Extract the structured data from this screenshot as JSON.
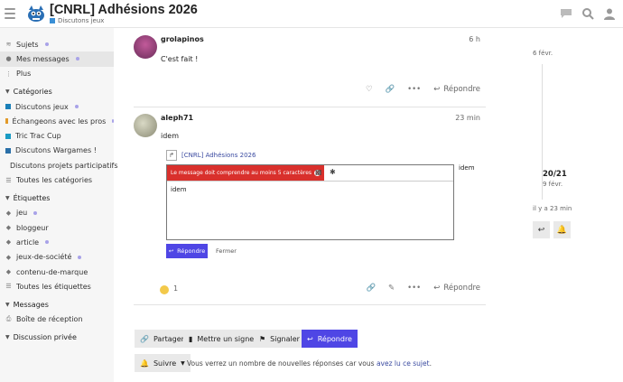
{
  "header": {
    "title": "[CNRL] Adhésions 2026",
    "category": "Discutons jeux",
    "category_color": "#3a8fd6"
  },
  "sidebar": {
    "top": [
      {
        "label": "Sujets",
        "icon": "layers-icon",
        "dot": true
      },
      {
        "label": "Mes messages",
        "icon": "user-icon",
        "dot": true,
        "active": true
      },
      {
        "label": "Plus",
        "icon": "more-vertical-icon",
        "dot": false
      }
    ],
    "categories_title": "Catégories",
    "categories": [
      {
        "label": "Discutons jeux",
        "color": "#1a7fb8",
        "dot": true
      },
      {
        "label": "Échangeons avec les pros",
        "color": "#e29a2a",
        "dot": true
      },
      {
        "label": "Tric Trac Cup",
        "color": "#1a9bc4",
        "dot": false
      },
      {
        "label": "Discutons Wargames !",
        "color": "#2a6fa8",
        "dot": false
      },
      {
        "label": "Discutons projets participatifs",
        "color": "#1a7fb8",
        "dot": false
      },
      {
        "label": "Toutes les catégories",
        "icon": "list-icon",
        "dot": false
      }
    ],
    "tags_title": "Étiquettes",
    "tags": [
      {
        "label": "jeu",
        "dot": true
      },
      {
        "label": "bloggeur",
        "dot": false
      },
      {
        "label": "article",
        "dot": true
      },
      {
        "label": "jeux-de-société",
        "dot": true
      },
      {
        "label": "contenu-de-marque",
        "dot": false
      },
      {
        "label": "Toutes les étiquettes",
        "icon": "list-icon",
        "dot": false
      }
    ],
    "messages_title": "Messages",
    "inbox": "Boîte de réception",
    "private_title": "Discussion privée"
  },
  "posts": [
    {
      "user": "grolapinos",
      "time": "6 h",
      "text": "C'est fait !"
    },
    {
      "user": "aleph71",
      "time": "23 min",
      "text": "idem"
    }
  ],
  "reply_label": "Répondre",
  "quote": {
    "title": "[CNRL] Adhésions 2026",
    "side_text": "idem"
  },
  "editor": {
    "error": "Le message doit comprendre au moins 5 caractères",
    "text": "idem",
    "reply_button": "Répondre",
    "close_button": "Fermer"
  },
  "reaction_count": "1",
  "timeline": {
    "top_date": "6 févr.",
    "count": "20/21",
    "count_date": "9 févr.",
    "bottom": "il y a 23 min"
  },
  "footer": {
    "share": "Partager",
    "bookmark": "Mettre un signet",
    "flag": "Signaler",
    "reply": "Répondre",
    "follow": "Suivre",
    "notice_prefix": "Vous verrez un nombre de nouvelles réponses car vous ",
    "notice_link": "avez lu ce sujet",
    "notice_suffix": "."
  }
}
